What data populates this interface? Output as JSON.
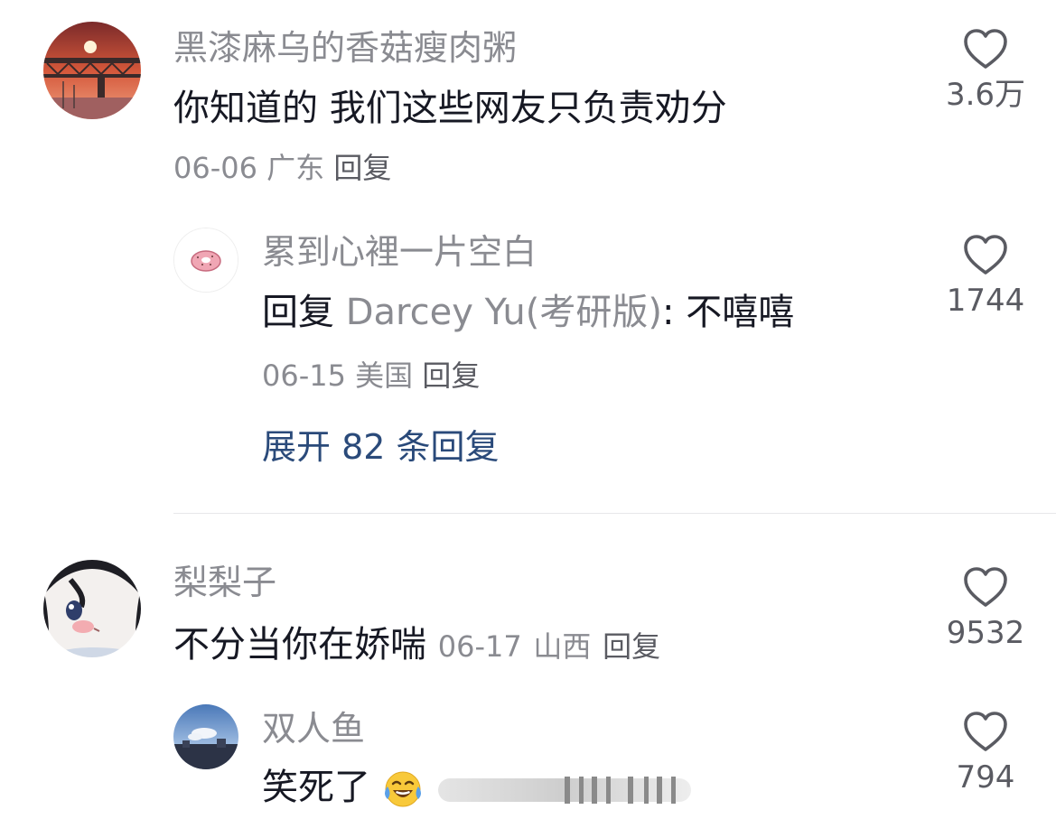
{
  "comments": [
    {
      "author": "黑漆麻乌的香菇瘦肉粥",
      "text": "你知道的 我们这些网友只负责劝分",
      "date": "06-06",
      "location": "广东",
      "reply_label": "回复",
      "likes": "3.6万",
      "replies": [
        {
          "author": "累到心裡一片空白",
          "reply_prefix": "回复",
          "mention": "Darcey Yu(考研版)",
          "text": ": 不嘻嘻",
          "date": "06-15",
          "location": "美国",
          "reply_label": "回复",
          "likes": "1744"
        }
      ],
      "expand_label": "展开 82 条回复"
    },
    {
      "author": "梨梨子",
      "text": "不分当你在娇喘",
      "date": "06-17",
      "location": "山西",
      "reply_label": "回复",
      "likes": "9532",
      "replies": [
        {
          "author": "双人鱼",
          "text": "笑死了",
          "likes": "794"
        }
      ]
    }
  ],
  "icons": {
    "like": "heart-outline-icon",
    "emoji": "face-with-tears-of-joy"
  },
  "colors": {
    "name": "#8a8b91",
    "text": "#161823",
    "expand": "#2a4a7a",
    "divider": "#e8e8ea"
  }
}
